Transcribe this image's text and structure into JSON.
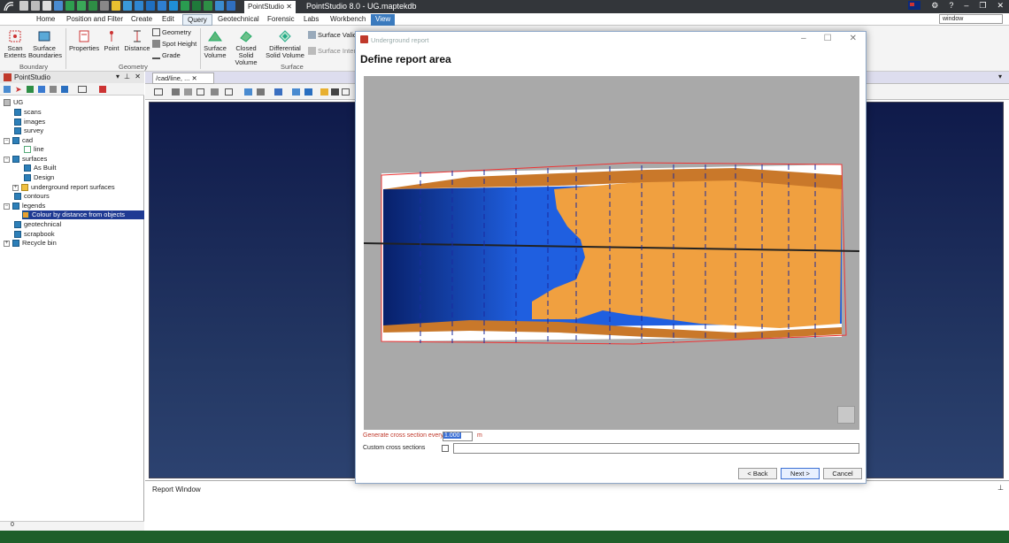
{
  "titlebar": {
    "app_tab": "PointStudio",
    "app_title": "PointStudio 8.0 - UG.maptekdb",
    "tab_close": "✕"
  },
  "menu": {
    "tabs": [
      "Home",
      "Position and Filter",
      "Create",
      "Edit",
      "Query",
      "Geotechnical",
      "Forensic",
      "Labs",
      "Workbench",
      "View"
    ],
    "active": "Query",
    "search_value": "window"
  },
  "ribbon": {
    "boundary": {
      "scan_extents": "Scan Extents",
      "surface_boundaries": "Surface Boundaries",
      "group": "Boundary"
    },
    "geometry": {
      "properties": "Properties",
      "point": "Point",
      "distance": "Distance",
      "geometry": "Geometry",
      "spot_height": "Spot Height",
      "grade": "Grade",
      "group": "Geometry"
    },
    "surface": {
      "surface_volume": "Surface Volume",
      "closed_solid_volume": "Closed Solid Volume",
      "differential_solid_volume": "Differential Solid Volume",
      "surface_valid": "Surface Valid",
      "surface_inter": "Surface Inter",
      "group": "Surface"
    }
  },
  "leftpanel": {
    "title": "PointStudio",
    "status_value": "0",
    "tree": [
      {
        "label": "UG"
      },
      {
        "label": "scans"
      },
      {
        "label": "images"
      },
      {
        "label": "survey"
      },
      {
        "label": "cad"
      },
      {
        "label": "line"
      },
      {
        "label": "surfaces"
      },
      {
        "label": "As Built"
      },
      {
        "label": "Design"
      },
      {
        "label": "underground report surfaces"
      },
      {
        "label": "contours"
      },
      {
        "label": "legends"
      },
      {
        "label": "Colour by distance from objects"
      },
      {
        "label": "geotechnical"
      },
      {
        "label": "scrapbook"
      },
      {
        "label": "Recycle bin"
      }
    ]
  },
  "view": {
    "tab_label": "/cad/line, ...",
    "report_window": "Report Window"
  },
  "dialog": {
    "title": "Underground report",
    "heading": "Define report area",
    "generate_label": "Generate cross section every",
    "spacing_value": "1.000",
    "unit": "m",
    "custom_label": "Custom cross sections",
    "back_button": "< Back",
    "next_button": "Next >",
    "cancel_button": "Cancel"
  },
  "colors": {
    "titlebar": "#33363a",
    "view_tab": "#3b7bbf",
    "selection": "#1f3a93",
    "tunnel_orange": "#f0a040",
    "tunnel_blue": "#1f5fe0",
    "status_green": "#1e5f2a"
  }
}
